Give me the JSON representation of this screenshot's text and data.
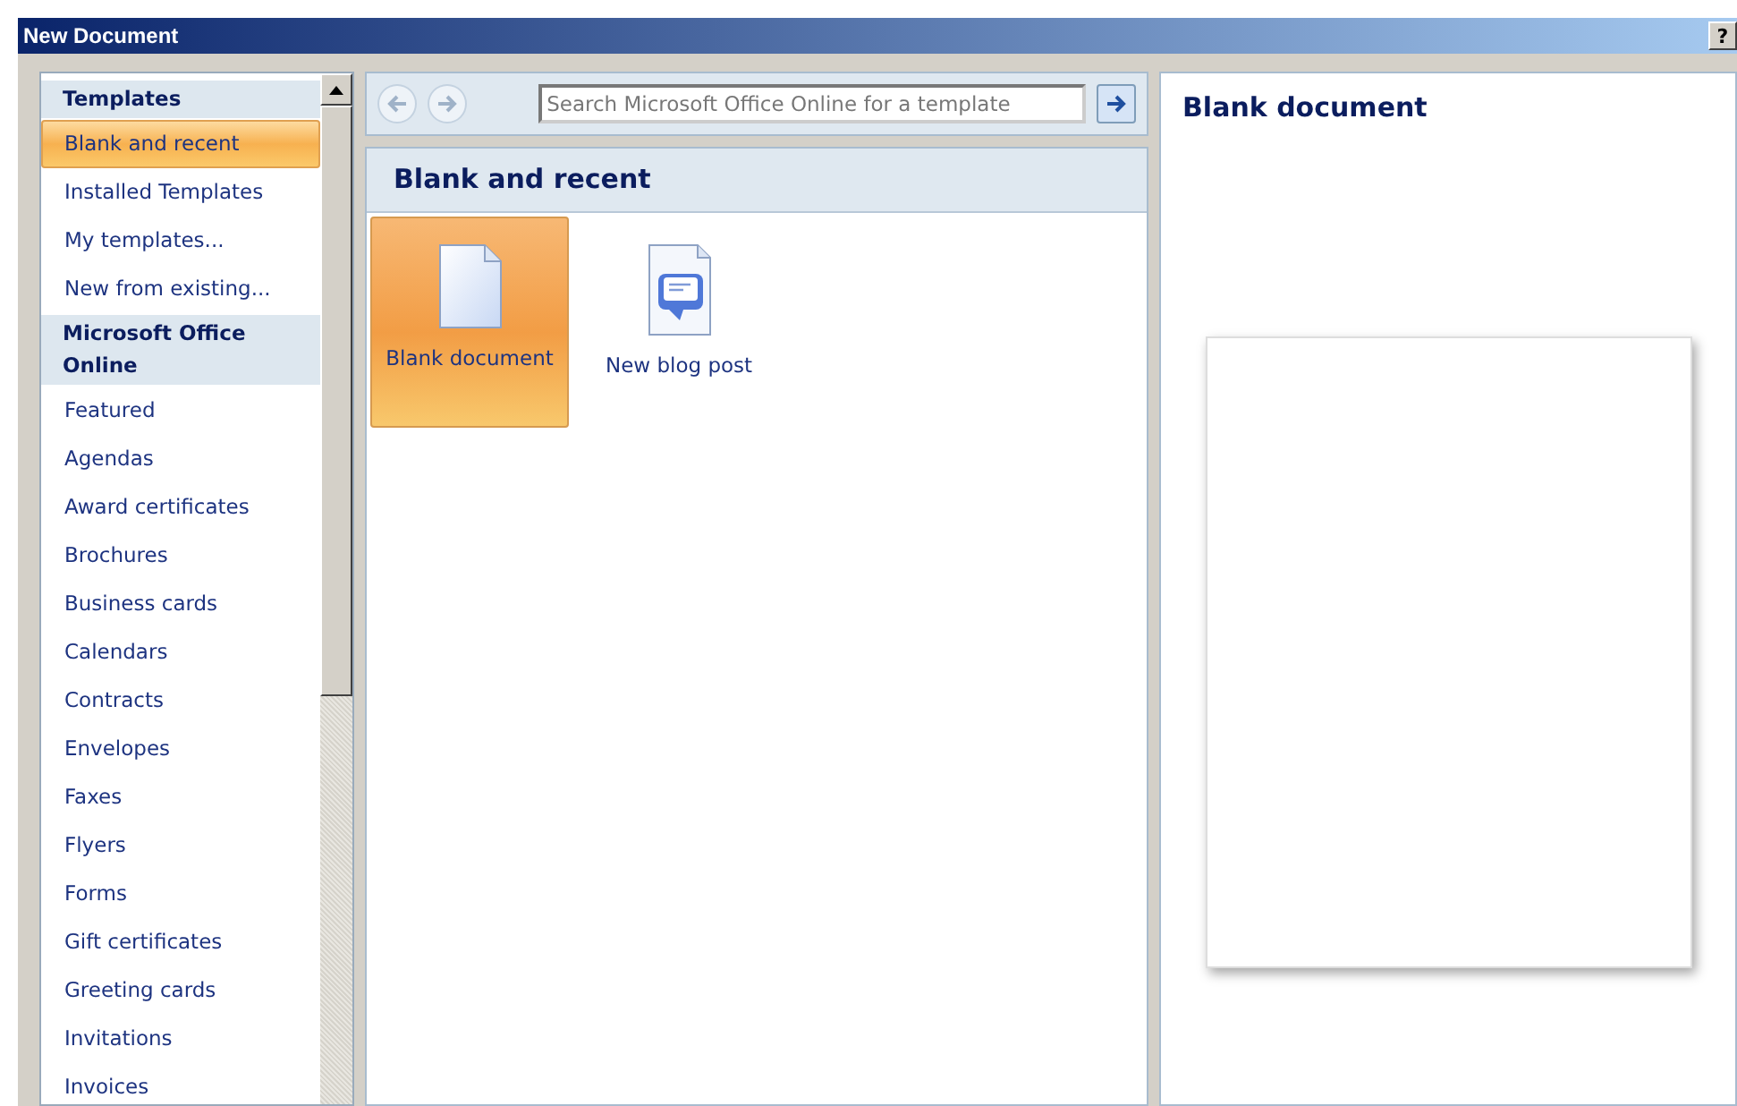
{
  "window": {
    "title": "New Document",
    "help_button": "?"
  },
  "sidebar": {
    "items": [
      {
        "kind": "heading",
        "label": "Templates"
      },
      {
        "kind": "item",
        "label": "Blank and recent",
        "selected": true
      },
      {
        "kind": "item",
        "label": "Installed Templates",
        "selected": false
      },
      {
        "kind": "item",
        "label": "My templates...",
        "selected": false
      },
      {
        "kind": "item",
        "label": "New from existing...",
        "selected": false
      },
      {
        "kind": "heading",
        "label": "Microsoft Office Online"
      },
      {
        "kind": "item",
        "label": "Featured",
        "selected": false
      },
      {
        "kind": "item",
        "label": "Agendas",
        "selected": false
      },
      {
        "kind": "item",
        "label": "Award certificates",
        "selected": false
      },
      {
        "kind": "item",
        "label": "Brochures",
        "selected": false
      },
      {
        "kind": "item",
        "label": "Business cards",
        "selected": false
      },
      {
        "kind": "item",
        "label": "Calendars",
        "selected": false
      },
      {
        "kind": "item",
        "label": "Contracts",
        "selected": false
      },
      {
        "kind": "item",
        "label": "Envelopes",
        "selected": false
      },
      {
        "kind": "item",
        "label": "Faxes",
        "selected": false
      },
      {
        "kind": "item",
        "label": "Flyers",
        "selected": false
      },
      {
        "kind": "item",
        "label": "Forms",
        "selected": false
      },
      {
        "kind": "item",
        "label": "Gift certificates",
        "selected": false
      },
      {
        "kind": "item",
        "label": "Greeting cards",
        "selected": false
      },
      {
        "kind": "item",
        "label": "Invitations",
        "selected": false
      },
      {
        "kind": "item",
        "label": "Invoices",
        "selected": false
      }
    ]
  },
  "search": {
    "placeholder": "Search Microsoft Office Online for a template"
  },
  "gallery": {
    "title": "Blank and recent",
    "templates": [
      {
        "kind": "blank",
        "label": "Blank document",
        "selected": true
      },
      {
        "kind": "blog",
        "label": "New blog post",
        "selected": false
      }
    ]
  },
  "preview": {
    "title": "Blank document"
  }
}
